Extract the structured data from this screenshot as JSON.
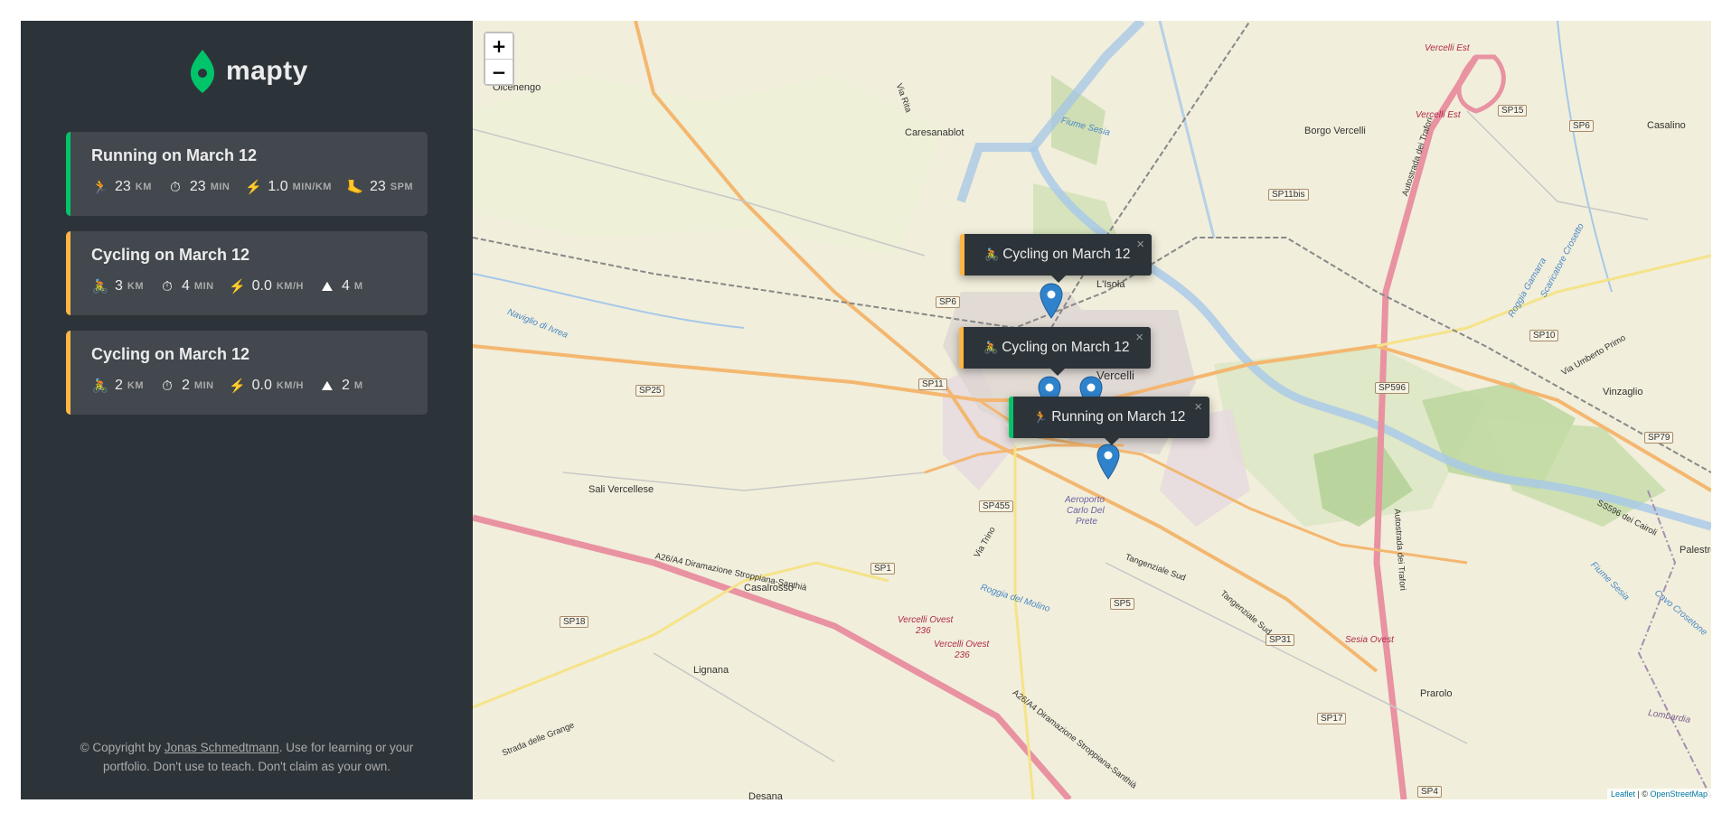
{
  "app": {
    "name": "mapty"
  },
  "workouts": [
    {
      "type": "running",
      "title": "Running on March 12",
      "details": [
        {
          "icon": "runner-icon",
          "glyph": "🏃",
          "value": "23",
          "unit": "km"
        },
        {
          "icon": "stopwatch-icon",
          "glyph": "⏱",
          "value": "23",
          "unit": "min"
        },
        {
          "icon": "lightning-icon",
          "glyph": "⚡",
          "value": "1.0",
          "unit": "min/km"
        },
        {
          "icon": "footprint-icon",
          "glyph": "🦶",
          "value": "23",
          "unit": "spm"
        }
      ]
    },
    {
      "type": "cycling",
      "title": "Cycling on March 12",
      "details": [
        {
          "icon": "cyclist-icon",
          "glyph": "🚴",
          "value": "3",
          "unit": "km"
        },
        {
          "icon": "stopwatch-icon",
          "glyph": "⏱",
          "value": "4",
          "unit": "min"
        },
        {
          "icon": "lightning-icon",
          "glyph": "⚡",
          "value": "0.0",
          "unit": "km/h"
        },
        {
          "icon": "mountain-icon",
          "glyph": "⛰",
          "value": "4",
          "unit": "m"
        }
      ]
    },
    {
      "type": "cycling",
      "title": "Cycling on March 12",
      "details": [
        {
          "icon": "cyclist-icon",
          "glyph": "🚴",
          "value": "2",
          "unit": "km"
        },
        {
          "icon": "stopwatch-icon",
          "glyph": "⏱",
          "value": "2",
          "unit": "min"
        },
        {
          "icon": "lightning-icon",
          "glyph": "⚡",
          "value": "0.0",
          "unit": "km/h"
        },
        {
          "icon": "mountain-icon",
          "glyph": "⛰",
          "value": "2",
          "unit": "m"
        }
      ]
    }
  ],
  "copyright": {
    "prefix": "© Copyright by ",
    "author": "Jonas Schmedtmann",
    "suffix": ". Use for learning or your portfolio. Don't use to teach. Don't claim as your own."
  },
  "map": {
    "zoom_in": "+",
    "zoom_out": "−",
    "popups": [
      {
        "type": "cycling",
        "glyph": "🚴",
        "label": "Cycling on March 12",
        "close": "×"
      },
      {
        "type": "cycling",
        "glyph": "🚴",
        "label": "Cycling on March 12",
        "close": "×"
      },
      {
        "type": "running",
        "glyph": "🏃",
        "label": "Running on March 12",
        "close": "×"
      }
    ],
    "places": [
      "Olcenengo",
      "Caresanablot",
      "Borgo Vercelli",
      "Casalino",
      "L'Isola",
      "Vercelli",
      "Sali Vercellese",
      "Casalrosso",
      "Lignana",
      "Prarolo",
      "Vinzaglio",
      "Palestro",
      "Desana",
      "Aeroporto",
      "Carlo Del",
      "Prete"
    ],
    "road_signs": [
      "SP15",
      "SP6",
      "SP11bis",
      "SP6",
      "SP11",
      "SP25",
      "SP455",
      "SP1",
      "SP18",
      "SP5",
      "SP31",
      "SP596",
      "SP10",
      "SP79",
      "SP17",
      "SP4"
    ],
    "road_names": [
      "Via Trino",
      "Tangenziale Sud",
      "Tangenziale Sud",
      "A26/A4 Diramazione Stroppiana-Santhià",
      "A26/A4 Diramazione Stroppiana-Santhià",
      "Strada delle Grange",
      "SS596 dei Cairoli",
      "Via Umberto Primo",
      "Autostrada dei Trafori",
      "Autostrada dei Trafori",
      "Via Rita"
    ],
    "water_names": [
      "Fiume Sesia",
      "Roggia del Molino",
      "Naviglio di Ivrea",
      "Roggia Gamarra",
      "Scaricatore Crosetto",
      "Lombardia",
      "Fiume Sesia",
      "Cavo Crosetone"
    ],
    "red_labels": [
      "Vercelli Est",
      "Vercelli Est",
      "Vercelli Ovest",
      "236",
      "Vercelli Ovest",
      "236",
      "Sesia Ovest"
    ],
    "attribution": {
      "leaflet": "Leaflet",
      "sep": " | © ",
      "osm": "OpenStreetMap"
    }
  }
}
